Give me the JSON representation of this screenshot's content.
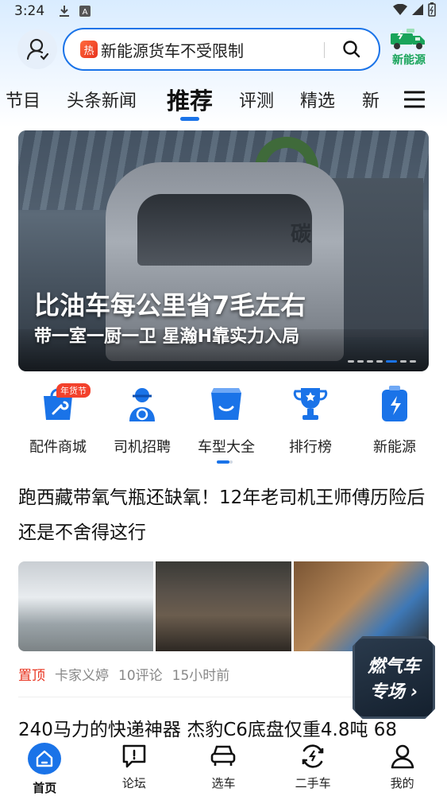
{
  "status_bar": {
    "time": "3:24"
  },
  "header": {
    "search_hot": "热",
    "search_placeholder": "新能源货车不受限制",
    "ev_label": "新能源"
  },
  "tabs": [
    {
      "label": "节目"
    },
    {
      "label": "头条新闻"
    },
    {
      "label": "推荐"
    },
    {
      "label": "评测"
    },
    {
      "label": "精选"
    },
    {
      "label": "新"
    }
  ],
  "banner": {
    "title": "比油车每公里省7毛左右",
    "subtitle": "带一室一厨一卫 星瀚H靠实力入局",
    "truck_text": "碳"
  },
  "quick_links": [
    {
      "label": "配件商城",
      "badge": "年货节",
      "icon": "wrench-bag-icon"
    },
    {
      "label": "司机招聘",
      "icon": "driver-icon"
    },
    {
      "label": "车型大全",
      "icon": "smile-bag-icon"
    },
    {
      "label": "排行榜",
      "icon": "trophy-icon"
    },
    {
      "label": "新能源",
      "icon": "battery-icon"
    }
  ],
  "article": {
    "title": "跑西藏带氧气瓶还缺氧！12年老司机王师傅历险后还是不舍得这行",
    "pinned": "置顶",
    "author": "卡家义婷",
    "comments": "10评论",
    "time": "15小时前"
  },
  "article2": {
    "title": "240马力的快递神器 杰豹C6底盘仅重4.8吨 68"
  },
  "float_card": {
    "line1": "燃气车",
    "line2": "专场 ›"
  },
  "bottom_nav": [
    {
      "label": "首页"
    },
    {
      "label": "论坛"
    },
    {
      "label": "选车"
    },
    {
      "label": "二手车"
    },
    {
      "label": "我的"
    }
  ],
  "colors": {
    "accent": "#1a73e8",
    "hot": "#e8321e",
    "ev_green": "#19a45a"
  }
}
